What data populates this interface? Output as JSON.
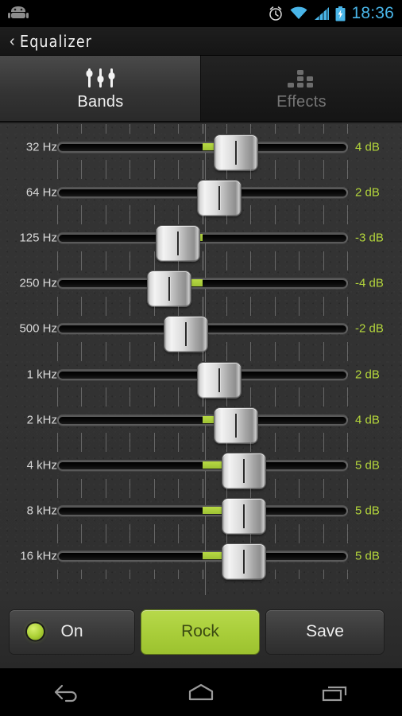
{
  "statusbar": {
    "time": "18:36",
    "icons": [
      "android-head-icon",
      "alarm-clock-icon",
      "wifi-icon",
      "signal-bars-icon",
      "battery-charging-icon"
    ],
    "accent_color": "#49b5e8"
  },
  "titlebar": {
    "back_chevron": "‹",
    "title": "Equalizer"
  },
  "tabs": [
    {
      "label": "Bands",
      "icon": "sliders-icon",
      "active": true
    },
    {
      "label": "Effects",
      "icon": "dot-matrix-icon",
      "active": false
    }
  ],
  "equalizer": {
    "min_db": -15,
    "max_db": 15,
    "tick_count": 13,
    "fill_color": "#a8cd39",
    "db_label_color": "#b4d63b",
    "freq_label_color": "#d8d8d8",
    "bands": [
      {
        "freq": "32 Hz",
        "db": 4,
        "db_label": "4 dB"
      },
      {
        "freq": "64 Hz",
        "db": 2,
        "db_label": "2 dB"
      },
      {
        "freq": "125 Hz",
        "db": -3,
        "db_label": "-3 dB"
      },
      {
        "freq": "250 Hz",
        "db": -4,
        "db_label": "-4 dB"
      },
      {
        "freq": "500 Hz",
        "db": -2,
        "db_label": "-2 dB"
      },
      {
        "freq": "1 kHz",
        "db": 2,
        "db_label": "2 dB"
      },
      {
        "freq": "2 kHz",
        "db": 4,
        "db_label": "4 dB"
      },
      {
        "freq": "4 kHz",
        "db": 5,
        "db_label": "5 dB"
      },
      {
        "freq": "8 kHz",
        "db": 5,
        "db_label": "5 dB"
      },
      {
        "freq": "16 kHz",
        "db": 5,
        "db_label": "5 dB"
      }
    ]
  },
  "buttons": {
    "power": {
      "label": "On",
      "led_on": true,
      "style": "dark"
    },
    "preset": {
      "label": "Rock",
      "style": "green"
    },
    "save": {
      "label": "Save",
      "style": "dark"
    }
  },
  "navbar": {
    "items": [
      {
        "name": "back-icon"
      },
      {
        "name": "home-icon"
      },
      {
        "name": "recents-icon"
      }
    ]
  }
}
